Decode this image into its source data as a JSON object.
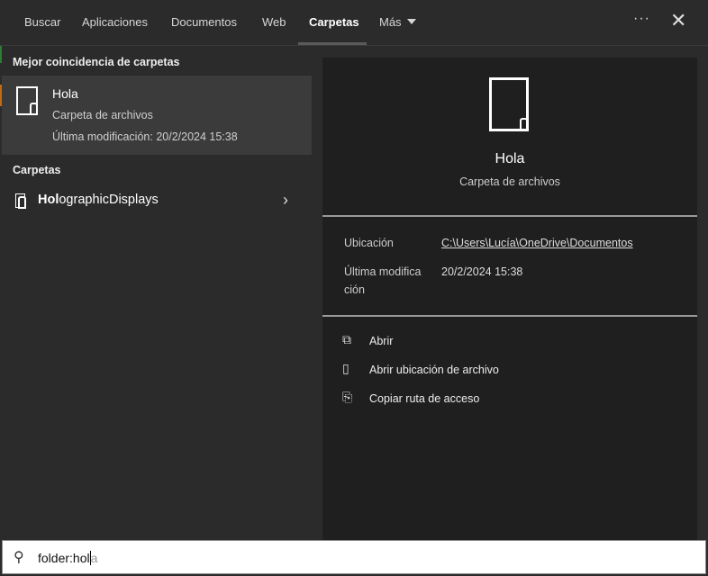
{
  "tabs": [
    "Buscar",
    "Aplicaciones",
    "Documentos",
    "Web",
    "Carpetas",
    "Más"
  ],
  "active_tab": "Carpetas",
  "toolbar": {
    "more_options": "···",
    "close": "✕"
  },
  "left": {
    "best_header": "Mejor coincidencia de carpetas",
    "best": {
      "title": "Hola",
      "type": "Carpeta de archivos",
      "modified": "Última modificación: 20/2/2024 15:38"
    },
    "folders_header": "Carpetas",
    "folders": [
      {
        "bold": "Hol",
        "rest": "ographicDisplays"
      }
    ]
  },
  "preview": {
    "title": "Hola",
    "type": "Carpeta de archivos",
    "location_label": "Ubicación",
    "location": "C:\\Users\\Lucía\\OneDrive\\Documentos",
    "modified_label_1": "Última modifica",
    "modified_label_2": "ción",
    "modified": "20/2/2024 15:38",
    "actions": [
      {
        "icon": "open-icon",
        "label": "Abrir"
      },
      {
        "icon": "open-location-icon",
        "label": "Abrir ubicación de archivo"
      },
      {
        "icon": "copy-path-icon",
        "label": "Copiar ruta de acceso"
      }
    ]
  },
  "search": {
    "typed": "folder:hol",
    "suggestion": "a"
  }
}
